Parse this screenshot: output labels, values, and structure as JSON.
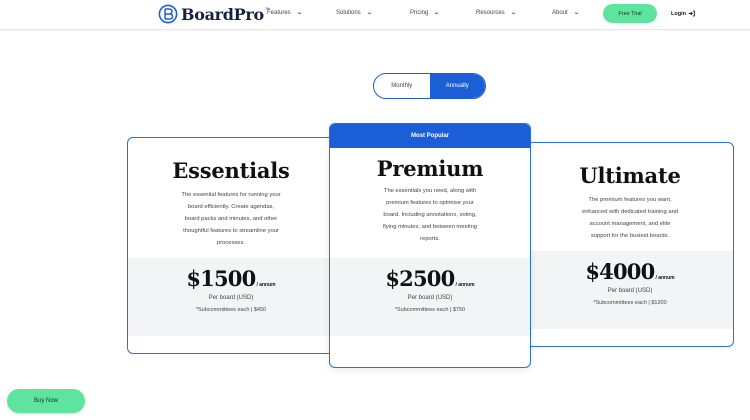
{
  "brand": {
    "name": "BoardPro",
    "tm": "™",
    "accent": "#1a5fd6",
    "green": "#5ee49d"
  },
  "nav": {
    "items": [
      {
        "label": "Features"
      },
      {
        "label": "Solutions"
      },
      {
        "label": "Pricing"
      },
      {
        "label": "Resources"
      },
      {
        "label": "About"
      }
    ],
    "trial_label": "Free Trial",
    "login_label": "Login",
    "login_icon": "login-arrow-icon"
  },
  "billing_toggle": {
    "options": [
      "Monthly",
      "Annually"
    ],
    "selected": "Annually"
  },
  "plans": [
    {
      "name": "Essentials",
      "badge": "",
      "desc_lines": [
        "The essential features for running your",
        "board efficiently. Create agendas,",
        "board packs and minutes, and other",
        "thoughtful features to streamline your",
        "processes."
      ],
      "price": "$1500",
      "period": "/ annum",
      "per_board": "Per board (USD)",
      "subcommittees": "*Subcommittees each | $450"
    },
    {
      "name": "Premium",
      "badge": "Most Popular",
      "desc_lines": [
        "The essentials you need, along with",
        "premium features to optimise your",
        "board. Including annotations, voting,",
        "flying minutes, and between meeting",
        "reports."
      ],
      "price": "$2500",
      "period": "/ annum",
      "per_board": "Per board (USD)",
      "subcommittees": "*Subcommittees each | $750"
    },
    {
      "name": "Ultimate",
      "badge": "",
      "desc_lines": [
        "The premium features you want,",
        "enhanced with dedicated training and",
        "account management, and elite",
        "support for the busiest boards."
      ],
      "price": "$4000",
      "period": "/ annum",
      "per_board": "Per board (USD)",
      "subcommittees": "*Subcommittees each | $1200"
    }
  ],
  "buy_now_label": "Buy Now"
}
